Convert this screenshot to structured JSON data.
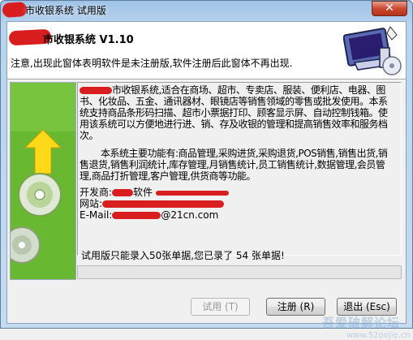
{
  "window": {
    "title": "市收银系统 试用版",
    "close_symbol": "✕"
  },
  "header": {
    "title": "市收银系统  V1.10",
    "notice": "注意,出现此窗体表明软件是未注册版,软件注册后此窗体不再出现."
  },
  "description": {
    "para1": "市收银系统,适合在商场、超市、专卖店、服装、便利店、电器、图书、化妆品、五金、通讯器材、眼镜店等销售领域的零售或批发使用。本系统支持商品条形码扫描、超市小票据打印、顾客显示屏、自动控制钱箱。使用该系统可以方便地进行进、销、存及收银的管理和提高销售效率和服务档次。",
    "para2": "本系统主要功能有:商品管理,采购进货,采购退货,POS销售,销售出货,销售退货,销售利润统计,库存管理,月销售统计,员工销售统计,数据管理,会员管理,商品打折管理,客户管理,供货商等功能。",
    "developer_label": "开发商:",
    "developer_suffix": "软件",
    "website_label": "网站:",
    "email_label": "E-Mail:",
    "email_suffix": "@21cn.com"
  },
  "status": {
    "text": "试用版只能录入50张单据,您已录了  54  张单据!",
    "progress": 0
  },
  "buttons": {
    "trial": "试用 (T)",
    "register": "注册 (R)",
    "exit": "退出 (Esc)"
  },
  "watermark": {
    "line1": "吾爱破解论坛",
    "line2": "www.52pojie.cn"
  },
  "colors": {
    "art_green": "#68b832",
    "redaction": "#d81e1e"
  }
}
